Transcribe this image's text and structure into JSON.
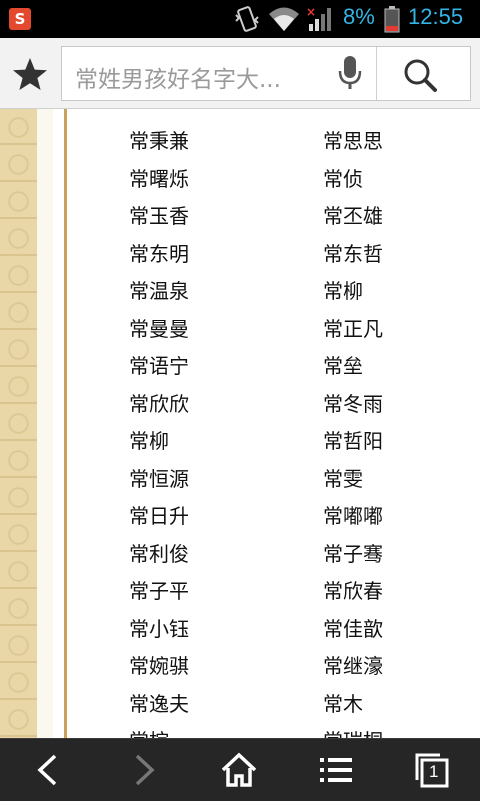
{
  "status_bar": {
    "battery_percent": "8%",
    "time": "12:55",
    "icons": [
      "app-notification-icon",
      "vibrate-icon",
      "wifi-icon",
      "signal-icon",
      "battery-icon"
    ]
  },
  "toolbar": {
    "search_query": "常姓男孩好名字大...",
    "icons": [
      "star-icon",
      "microphone-icon",
      "search-icon"
    ]
  },
  "names": {
    "left": [
      "常秉兼",
      "常曙烁",
      "常玉香",
      "常东明",
      "常温泉",
      "常曼曼",
      "常语宁",
      "常欣欣",
      "常柳",
      "常恒源",
      "常日升",
      "常利俊",
      "常子平",
      "常小钰",
      "常婉骐",
      "常逸夫",
      "常棕"
    ],
    "right": [
      "常思思",
      "常侦",
      "常丕雄",
      "常东哲",
      "常柳",
      "常正凡",
      "常垒",
      "常冬雨",
      "常哲阳",
      "常雯",
      "常嘟嘟",
      "常子骞",
      "常欣春",
      "常佳歆",
      "常继濠",
      "常木",
      "常瑞桐"
    ]
  },
  "bottom_nav": {
    "tab_count": "1",
    "icons": [
      "back-icon",
      "forward-icon",
      "home-icon",
      "menu-icon",
      "tabs-icon"
    ]
  },
  "colors": {
    "accent": "#33b5e5",
    "status_bar_bg": "#000000",
    "bottom_bar_bg": "#262626",
    "side_pattern": "#e9d7a8",
    "divider_line": "#c9a35c"
  }
}
